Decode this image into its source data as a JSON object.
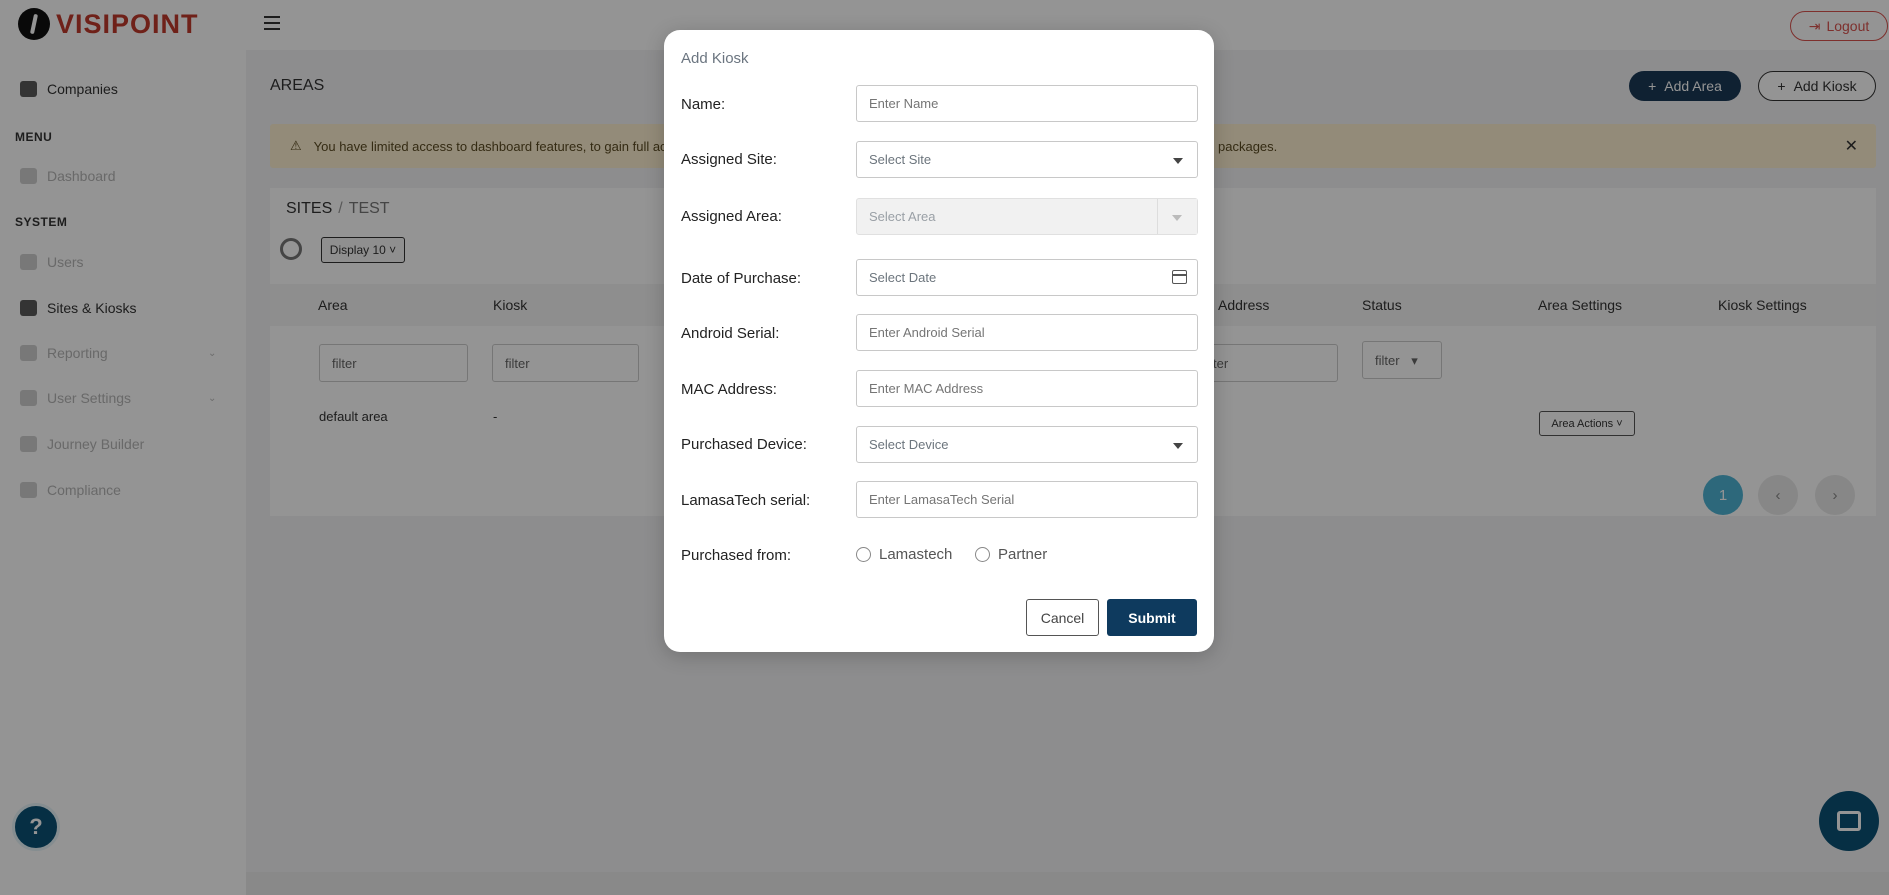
{
  "brand": {
    "logo_text": "VISIPOINT"
  },
  "topbar": {
    "logout_label": "Logout"
  },
  "sidebar": {
    "companies": "Companies",
    "menu_section": "MENU",
    "dashboard": "Dashboard",
    "system_section": "SYSTEM",
    "users": "Users",
    "sites_kiosks": "Sites & Kiosks",
    "reporting": "Reporting",
    "user_settings": "User Settings",
    "journey_builder": "Journey Builder",
    "compliance": "Compliance"
  },
  "page": {
    "title": "AREAS",
    "add_area": "Add Area",
    "add_kiosk": "Add Kiosk",
    "alert_text": "You have limited access to dashboard features, to gain full acce",
    "alert_tail": "packages.",
    "breadcrumb_root": "SITES",
    "breadcrumb_sep": "/",
    "breadcrumb_current": "TEST",
    "display_label": "Display 10",
    "columns": {
      "area": "Area",
      "kiosk": "Kiosk",
      "address": "Address",
      "status": "Status",
      "area_settings": "Area Settings",
      "kiosk_settings": "Kiosk Settings"
    },
    "filter_placeholder": "filter",
    "filter_partial": "ter",
    "status_filter": "filter",
    "row": {
      "area": "default area",
      "kiosk": "-",
      "area_actions": "Area Actions"
    },
    "pagination": {
      "current": "1"
    }
  },
  "modal": {
    "title": "Add Kiosk",
    "fields": {
      "name": {
        "label": "Name:",
        "placeholder": "Enter Name"
      },
      "site": {
        "label": "Assigned Site:",
        "placeholder": "Select Site"
      },
      "area": {
        "label": "Assigned Area:",
        "placeholder": "Select Area"
      },
      "date": {
        "label": "Date of Purchase:",
        "placeholder": "Select Date"
      },
      "android": {
        "label": "Android Serial:",
        "placeholder": "Enter Android Serial"
      },
      "mac": {
        "label": "MAC Address:",
        "placeholder": "Enter MAC Address"
      },
      "device": {
        "label": "Purchased Device:",
        "placeholder": "Select Device"
      },
      "lamasa": {
        "label": "LamasaTech serial:",
        "placeholder": "Enter LamasaTech Serial"
      },
      "purchased_from": {
        "label": "Purchased from:",
        "options": [
          "Lamastech",
          "Partner"
        ]
      }
    },
    "cancel": "Cancel",
    "submit": "Submit"
  },
  "colors": {
    "primary": "#0e3a5e",
    "accent_red": "#d9534f",
    "alert_bg": "#fdf0d0",
    "pager_active": "#4fb3d4"
  }
}
